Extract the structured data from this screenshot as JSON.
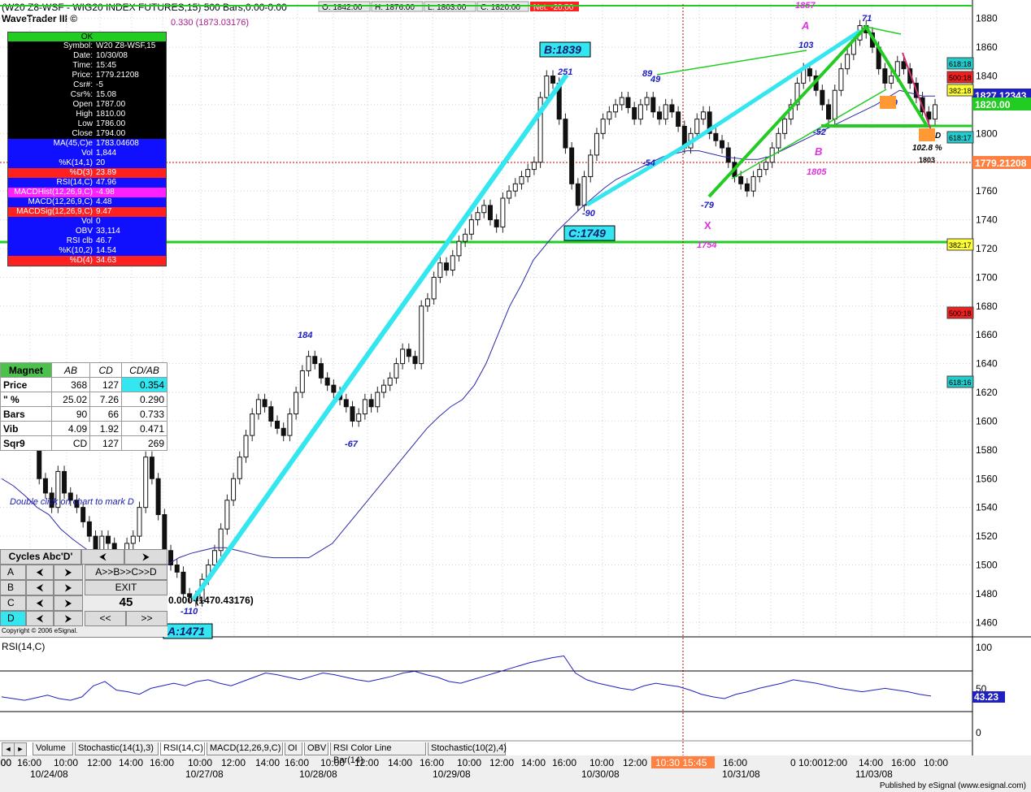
{
  "header": {
    "title": "(W20 Z8-WSF - WIG20 INDEX FUTURES,15) 500 Bars,0:00-0:00",
    "app_name": "WaveTrader III ©",
    "ohlc": [
      "O: 1842.00",
      "H: 1876.00",
      "L: 1803.00",
      "C: 1820.00"
    ],
    "net": "Net: -20.00",
    "subtitle": "0.330 (1873.03176)"
  },
  "info_panel": {
    "status": "OK",
    "rows": [
      {
        "k": "Symbol:",
        "v": "W20 Z8-WSF,15",
        "bg": "#000000",
        "fg": "#ffffff"
      },
      {
        "k": "Date:",
        "v": "10/30/08",
        "bg": "#000000",
        "fg": "#ffffff"
      },
      {
        "k": "Time:",
        "v": "15:45",
        "bg": "#000000",
        "fg": "#ffffff"
      },
      {
        "k": "Price:",
        "v": "1779.21208",
        "bg": "#000000",
        "fg": "#ffffff"
      },
      {
        "k": "Csr#:",
        "v": "-5",
        "bg": "#000000",
        "fg": "#ffffff"
      },
      {
        "k": "Csr%:",
        "v": "15.08",
        "bg": "#000000",
        "fg": "#ffffff"
      },
      {
        "k": "Open",
        "v": "1787.00",
        "bg": "#000000",
        "fg": "#ffffff"
      },
      {
        "k": "High",
        "v": "1810.00",
        "bg": "#000000",
        "fg": "#ffffff"
      },
      {
        "k": "Low",
        "v": "1786.00",
        "bg": "#000000",
        "fg": "#ffffff"
      },
      {
        "k": "Close",
        "v": "1794.00",
        "bg": "#000000",
        "fg": "#ffffff"
      },
      {
        "k": "MA(45,C)e",
        "v": "1783.04608",
        "bg": "#1010ff",
        "fg": "#ffffff"
      },
      {
        "k": "Vol",
        "v": "1,844",
        "bg": "#1010ff",
        "fg": "#ffffff"
      },
      {
        "k": "%K(14,1)",
        "v": "20",
        "bg": "#1010ff",
        "fg": "#ffffff"
      },
      {
        "k": "%D(3)",
        "v": "23.89",
        "bg": "#ff2020",
        "fg": "#ffffff"
      },
      {
        "k": "RSI(14,C)",
        "v": "47.96",
        "bg": "#1010ff",
        "fg": "#ffffff"
      },
      {
        "k": "MACDHist(12,26,9,C)",
        "v": "-4.98",
        "bg": "#ff20ff",
        "fg": "#ffffff"
      },
      {
        "k": "MACD(12,26,9,C)",
        "v": "4.48",
        "bg": "#1010ff",
        "fg": "#ffffff"
      },
      {
        "k": "MACDSig(12,26,9,C)",
        "v": "9.47",
        "bg": "#ff2020",
        "fg": "#ffffff"
      },
      {
        "k": "Vol",
        "v": "0",
        "bg": "#1010ff",
        "fg": "#ffffff"
      },
      {
        "k": "OBV",
        "v": "33,114",
        "bg": "#1010ff",
        "fg": "#ffffff"
      },
      {
        "k": "RSI clb",
        "v": "46.7",
        "bg": "#1010ff",
        "fg": "#ffffff"
      },
      {
        "k": "%K(10,2)",
        "v": "14.54",
        "bg": "#1010ff",
        "fg": "#ffffff"
      },
      {
        "k": "%D(4)",
        "v": "34.63",
        "bg": "#ff2020",
        "fg": "#ffffff"
      }
    ]
  },
  "magnet": {
    "headers": [
      "Magnet",
      "AB",
      "CD",
      "CD/AB"
    ],
    "rows": [
      [
        "Price",
        "368",
        "127",
        "0.354"
      ],
      [
        "\" %",
        "25.02",
        "7.26",
        "0.290"
      ],
      [
        "Bars",
        "90",
        "66",
        "0.733"
      ],
      [
        "Vib",
        "4.09",
        "1.92",
        "0.471"
      ],
      [
        "Sqr9",
        "CD",
        "127",
        "269"
      ]
    ],
    "hint": "Double click on chart to mark D"
  },
  "cycles": {
    "title": "Cycles Abc'D'",
    "rows": [
      "A",
      "B",
      "C",
      "D"
    ],
    "abcd": "A>>B>>C>>D",
    "exit": "EXIT",
    "value": "45",
    "prev": "<<",
    "next": ">>",
    "copyright": "Copyright © 2006 eSignal."
  },
  "rsi_panel": {
    "label": "RSI(14,C)",
    "last": "43.23",
    "ticks": [
      "100",
      "50",
      "0"
    ]
  },
  "tabs": [
    "Volume",
    "Stochastic(14(1),3)",
    "RSI(14,C)",
    "MACD(12,26,9,C)",
    "OI",
    "OBV",
    "RSI Color Line Bar(14)",
    "Stochastic(10(2),4)"
  ],
  "selected_tab": "RSI(14,C)",
  "footer": "Published by eSignal (www.esignal.com)",
  "x_axis": {
    "times": [
      "16:00",
      "10:00",
      "12:00",
      "14:00",
      "16:00",
      "10:00",
      "12:00",
      "14:00",
      "16:00",
      "10:00",
      "12:00",
      "14:00",
      "16:00",
      "10:00",
      "12:00",
      "14:00",
      "16:00",
      "10:00",
      "12:00",
      "14:00",
      "16:00",
      "10:30 15:45",
      "0 10:00",
      "12:00",
      "14:00",
      "16:00",
      "10:00",
      "12:00",
      "14:00"
    ],
    "dates": [
      "10/24/08",
      "10/27/08",
      "10/28/08",
      "10/29/08",
      "10/30/08",
      "10/31/08",
      "11/03/08"
    ]
  },
  "price_tags": {
    "last": "1827.12343",
    "close": "1820.00",
    "cursor": "1779.21208",
    "fib": [
      "618:18",
      "500:18",
      "382:18",
      "618:17",
      "382:17",
      "500:18",
      "618:16"
    ]
  },
  "pattern_labels": {
    "B_box": "B:1839",
    "C_box": "C:1749",
    "A_box": "A:1471",
    "start": "0.000 (1470.43176)",
    "waves": [
      "251",
      "-110",
      "184",
      "-67",
      "-90",
      "89",
      "49",
      "-54",
      "-79",
      "103",
      "-52",
      "71",
      "-50",
      "-53"
    ],
    "X": "X",
    "X_val": "1754",
    "A": "A",
    "A_val": "1857",
    "B": "B",
    "B_val": "1805",
    "pct": "102.8 %",
    "D_val": "1803",
    "D": "D"
  },
  "colors": {
    "cyan": "#33e6f0",
    "green": "#22cc22",
    "magenta": "#dd33dd",
    "blue": "#1a1ab8",
    "red": "#cc0000"
  },
  "chart_data": {
    "type": "line",
    "title": "(W20 Z8-WSF - WIG20 INDEX FUTURES,15) 500 Bars,0:00-0:00",
    "xlabel": "",
    "ylabel": "",
    "ylim": [
      1450,
      1890
    ],
    "yticks": [
      1460,
      1480,
      1500,
      1520,
      1540,
      1560,
      1580,
      1600,
      1620,
      1640,
      1660,
      1680,
      1700,
      1720,
      1740,
      1760,
      1780,
      1800,
      1820,
      1840,
      1860,
      1880
    ],
    "series": [
      {
        "values": [
          1625,
          1618,
          1612,
          1620,
          1608,
          1600,
          1560,
          1550,
          1540,
          1565,
          1550,
          1545,
          1540,
          1530,
          1520,
          1510,
          1520,
          1515,
          1505,
          1500,
          1515,
          1520,
          1540,
          1575,
          1560,
          1535,
          1510,
          1500,
          1495,
          1480,
          1478,
          1475,
          1490,
          1500,
          1510,
          1525,
          1545,
          1560,
          1575,
          1590,
          1605,
          1615,
          1610,
          1600,
          1595,
          1590,
          1605,
          1620,
          1635,
          1645,
          1640,
          1630,
          1625,
          1620,
          1615,
          1610,
          1600,
          1605,
          1615,
          1610,
          1620,
          1625,
          1630,
          1640,
          1650,
          1645,
          1640,
          1680,
          1685,
          1700,
          1710,
          1705,
          1715,
          1725,
          1730,
          1740,
          1745,
          1750,
          1740,
          1735,
          1755,
          1760,
          1765,
          1770,
          1775,
          1780,
          1825,
          1840,
          1835,
          1810,
          1790,
          1765,
          1750,
          1770,
          1785,
          1800,
          1810,
          1815,
          1820,
          1825,
          1818,
          1810,
          1820,
          1825,
          1815,
          1810,
          1820,
          1815,
          1805,
          1790,
          1800,
          1810,
          1815,
          1800,
          1795,
          1790,
          1780,
          1770,
          1765,
          1760,
          1770,
          1775,
          1780,
          1790,
          1800,
          1810,
          1820,
          1835,
          1845,
          1840,
          1830,
          1820,
          1810,
          1830,
          1845,
          1855,
          1865,
          1875,
          1870,
          1860,
          1845,
          1835,
          1840,
          1850,
          1845,
          1835,
          1825,
          1815,
          1810,
          1820
        ]
      },
      {
        "values": [
          1560,
          1555,
          1548,
          1540,
          1535,
          1525,
          1518,
          1512,
          1506,
          1500,
          1496,
          1492,
          1490,
          1495,
          1500,
          1505,
          1508,
          1510,
          1512,
          1512,
          1510,
          1508,
          1506,
          1505,
          1505,
          1505,
          1505,
          1510,
          1515,
          1525,
          1535,
          1545,
          1555,
          1565,
          1575,
          1585,
          1595,
          1603,
          1610,
          1615,
          1625,
          1640,
          1660,
          1680,
          1695,
          1712,
          1722,
          1732,
          1740,
          1748,
          1755,
          1762,
          1768,
          1772,
          1776,
          1780,
          1784,
          1786,
          1788,
          1788,
          1786,
          1784,
          1783,
          1782,
          1782,
          1784,
          1788,
          1792,
          1796,
          1800,
          1804,
          1808,
          1812,
          1816,
          1820,
          1825,
          1830,
          1828,
          1826,
          1826
        ]
      }
    ],
    "rsi": {
      "ylim": [
        0,
        100
      ],
      "values": [
        42,
        40,
        38,
        41,
        44,
        40,
        38,
        42,
        55,
        60,
        50,
        48,
        45,
        52,
        55,
        58,
        55,
        60,
        62,
        58,
        55,
        60,
        65,
        70,
        68,
        65,
        62,
        66,
        70,
        68,
        65,
        62,
        60,
        63,
        66,
        70,
        72,
        68,
        65,
        60,
        58,
        62,
        66,
        70,
        74,
        78,
        82,
        85,
        88,
        90,
        70,
        62,
        58,
        55,
        52,
        50,
        55,
        58,
        56,
        54,
        50,
        45,
        42,
        40,
        45,
        48,
        52,
        55,
        58,
        62,
        60,
        58,
        55,
        52,
        50,
        48,
        50,
        52,
        50,
        48,
        45,
        43
      ]
    }
  }
}
